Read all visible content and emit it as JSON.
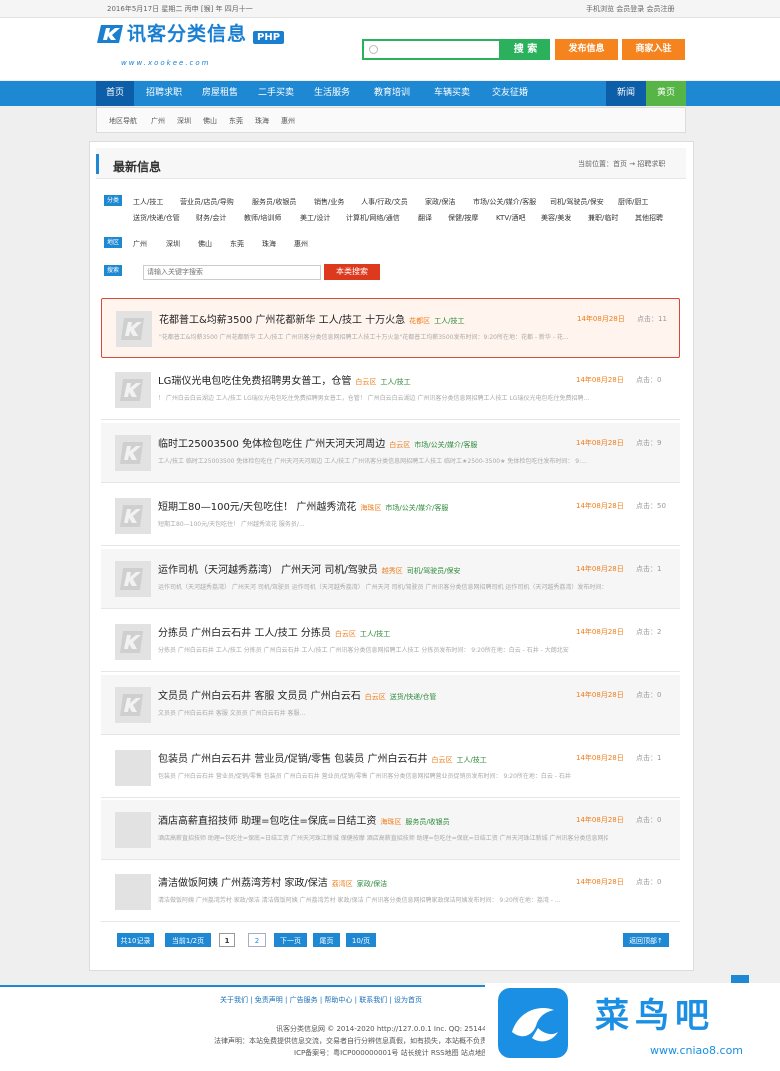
{
  "topbar": {
    "date": "2016年5月17日 星期二 丙申 [猴] 年 四月十一",
    "right_links": "手机浏览  会员登录  会员注册"
  },
  "header": {
    "logo_name": "讯客分类信息",
    "logo_badge": "PHP",
    "logo_url": "www.xookee.com",
    "search_placeholder": "",
    "search_button": "搜 索",
    "post_button": "发布信息",
    "shop_button": "商家入驻"
  },
  "nav": {
    "items": [
      "首页",
      "招聘求职",
      "房屋租售",
      "二手买卖",
      "生活服务",
      "教育培训",
      "车辆买卖",
      "交友征婚"
    ],
    "right_items": [
      "新闻",
      "黄页"
    ]
  },
  "area_nav": {
    "label": "地区导航",
    "items": [
      "广州",
      "深圳",
      "佛山",
      "东莞",
      "珠海",
      "惠州"
    ]
  },
  "panel": {
    "title": "最新信息",
    "breadcrumb": "当前位置：首页 → 招聘求职"
  },
  "filters": {
    "category_label": "分类",
    "categories_row1": [
      "工人/技工",
      "营业员/店员/导购",
      "服务员/收银员",
      "销售/业务",
      "人事/行政/文员",
      "家政/保洁",
      "市场/公关/媒介/客服",
      "司机/驾驶员/保安",
      "厨师/厨工"
    ],
    "categories_row2": [
      "送货/快递/仓管",
      "财务/会计",
      "教师/培训师",
      "美工/设计",
      "计算机/网络/通信",
      "翻译",
      "保健/按摩",
      "KTV/酒吧",
      "美容/美发",
      "兼职/临时",
      "其他招聘"
    ],
    "area_label": "地区",
    "areas": [
      "广州",
      "深圳",
      "佛山",
      "东莞",
      "珠海",
      "惠州"
    ],
    "keyword_label": "搜索",
    "keyword_placeholder": "请输入关键字搜索",
    "keyword_button": "本类搜索"
  },
  "listings": [
    {
      "title": "花都普工&均薪3500 广州花都新华 工人/技工 十万火急",
      "area": "花都区",
      "category": "工人/技工",
      "desc": "\"花都普工&均薪3500 广州花都新华 工人/技工 广州讯客分类信息网招聘工人技工十万火急\"花都普工均薪3500发布时间：9:20所在地：花都 - 新华 - 花...",
      "date": "14年08月28日",
      "hits": "点击：11",
      "thumb": true
    },
    {
      "title": "LG瑞仪光电包吃住免费招聘男女普工，仓管",
      "area": "白云区",
      "category": "工人/技工",
      "desc": "！ 广州白云白云湖边 工人/技工 LG瑞仪光电包吃住免费招聘男女普工，仓管！ 广州白云白云湖边 广州讯客分类信息网招聘工人技工 LG瑞仪光电包吃住免费招聘...",
      "date": "14年08月28日",
      "hits": "点击：0",
      "thumb": true
    },
    {
      "title": "临时工25003500 免体检包吃住 广州天河天河周边",
      "area": "白云区",
      "category": "市场/公关/媒介/客服",
      "desc": "工人/技工 临时工25003500 免体检包吃住 广州天河天河周边 工人/技工 广州讯客分类信息网招聘工人技工 临时工★2500-3500★ 免体检包吃住发布时间： 9:...",
      "date": "14年08月28日",
      "hits": "点击：9",
      "thumb": true
    },
    {
      "title": "短期工80—100元/天包吃住！ 广州越秀流花",
      "area": "海珠区",
      "category": "市场/公关/媒介/客服",
      "desc": "短期工80—100元/天包吃住！ 广州越秀流花 服务员/...",
      "date": "14年08月28日",
      "hits": "点击：50",
      "thumb": true
    },
    {
      "title": "运作司机（天河越秀荔湾） 广州天河 司机/驾驶员",
      "area": "越秀区",
      "category": "司机/驾驶员/保安",
      "desc": "运作司机（天河越秀荔湾） 广州天河 司机/驾驶员 运作司机（天河越秀荔湾） 广州天河 司机/驾驶员 广州讯客分类信息网招聘司机 运作司机（天河越秀荔湾）发布时间：",
      "date": "14年08月28日",
      "hits": "点击：1",
      "thumb": true
    },
    {
      "title": "分拣员 广州白云石井 工人/技工 分拣员",
      "area": "白云区",
      "category": "工人/技工",
      "desc": "分拣员 广州白云石井 工人/技工 分拣员 广州白云石井 工人/技工 广州讯客分类信息网招聘工人技工 分拣员发布时间： 9:20所在地：白云 - 石井 - 大朗北安",
      "date": "14年08月28日",
      "hits": "点击：2",
      "thumb": true
    },
    {
      "title": "文员员 广州白云石井 客服 文员员 广州白云石",
      "area": "白云区",
      "category": "送货/快递/仓管",
      "desc": "文员员 广州白云石井 客服 文员员 广州白云石井 客服...",
      "date": "14年08月28日",
      "hits": "点击：0",
      "thumb": true
    },
    {
      "title": "包装员 广州白云石井 营业员/促销/零售 包装员 广州白云石井",
      "area": "白云区",
      "category": "工人/技工",
      "desc": "包装员 广州白云石井 营业员/促销/零售 包装员 广州白云石井 营业员/促销/零售 广州讯客分类信息网招聘营业员促销员发布时间： 9:20所在地：白云 - 石井",
      "date": "14年08月28日",
      "hits": "点击：1",
      "thumb": false
    },
    {
      "title": "酒店高薪直招技师 助理=包吃住=保底=日结工资",
      "area": "海珠区",
      "category": "服务员/收银员",
      "desc": "酒店高薪直招技师 助理=包吃住=保底=日结工资 广州天河珠江新城 保健按摩 酒店高薪直招技师 助理=包吃住=保底=日结工资 广州天河珠江新城 广州讯客分类信息网招聘",
      "date": "14年08月28日",
      "hits": "点击：0",
      "thumb": false
    },
    {
      "title": "清洁做饭阿姨 广州荔湾芳村 家政/保洁",
      "area": "荔湾区",
      "category": "家政/保洁",
      "desc": "清洁做饭阿姨 广州荔湾芳村 家政/保洁 清洁做饭阿姨 广州荔湾芳村 家政/保洁 广州讯客分类信息网招聘家政保洁阿姨发布时间： 9:20所在地：荔湾 - ...",
      "date": "14年08月28日",
      "hits": "点击：0",
      "thumb": false
    }
  ],
  "pagination": {
    "total": "共10记录",
    "current": "当前1/2页",
    "pages": [
      "1",
      "2"
    ],
    "next": "下一页",
    "last": "尾页",
    "per_page": "10/页",
    "back_top": "返回顶部↑"
  },
  "footer": {
    "links": "关于我们  |  免责声明  |  广告服务  |  帮助中心  |  联系我们  |  设为首页",
    "copyright": "讯客分类信息网 © 2014-2020 http://127.0.0.1 Inc. QQ: 25144",
    "notice": "法律声明：本站免费提供信息交流，交易者自行分辨信息真假，如有损失，本站概不负责",
    "icp": "ICP备案号：粤ICP000000001号   站长统计 RSS地图 站点地图"
  },
  "watermark": {
    "brand": "菜鸟吧",
    "url": "www.cniao8.com"
  }
}
